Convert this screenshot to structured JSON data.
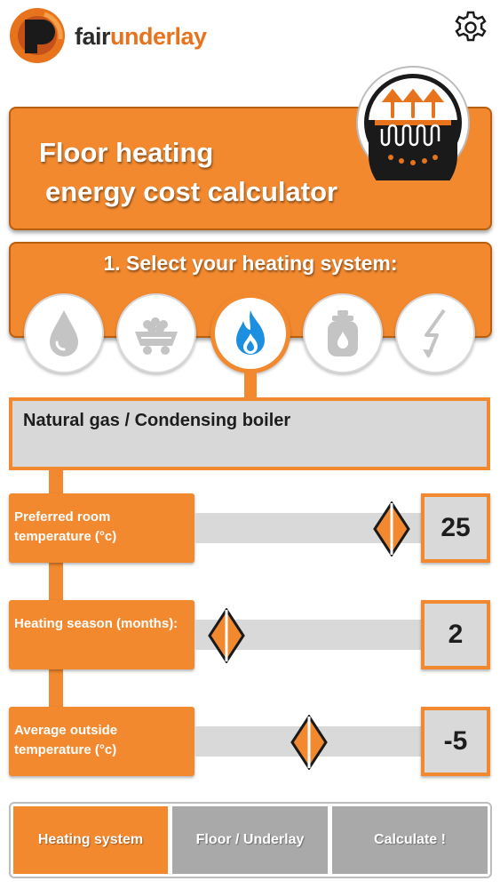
{
  "header": {
    "brand_prefix": "fair",
    "brand_suffix": "underlay",
    "logo_icon": "fairunderlay-logo-icon",
    "settings_icon": "gear-icon"
  },
  "title": {
    "line1": "Floor heating",
    "line2": "energy cost calculator"
  },
  "heating_system": {
    "heading": "1. Select your heating system:",
    "options": [
      {
        "icon": "oil-drop-icon",
        "selected": false
      },
      {
        "icon": "coal-cart-icon",
        "selected": false
      },
      {
        "icon": "gas-flame-icon",
        "selected": true
      },
      {
        "icon": "gas-cylinder-icon",
        "selected": false
      },
      {
        "icon": "electricity-bolt-icon",
        "selected": false
      }
    ],
    "selected_label": "Natural gas / Condensing boiler"
  },
  "sliders": [
    {
      "label": "Preferred room temperature (°c)",
      "value": "25",
      "position": 0.86
    },
    {
      "label": "Heating season (months):",
      "value": "2",
      "position": 0.14
    },
    {
      "label": "Average outside temperature (°c)",
      "value": "-5",
      "position": 0.5
    }
  ],
  "tabs": [
    {
      "label": "Heating system",
      "active": true
    },
    {
      "label": "Floor / Underlay",
      "active": false
    },
    {
      "label": "Calculate !",
      "active": false
    }
  ],
  "colors": {
    "accent": "#f2892f",
    "accent_dark": "#b9600f",
    "track": "#d9d9d9",
    "flame_blue": "#1d8fe0",
    "icon_gray": "#c4c4c4"
  }
}
